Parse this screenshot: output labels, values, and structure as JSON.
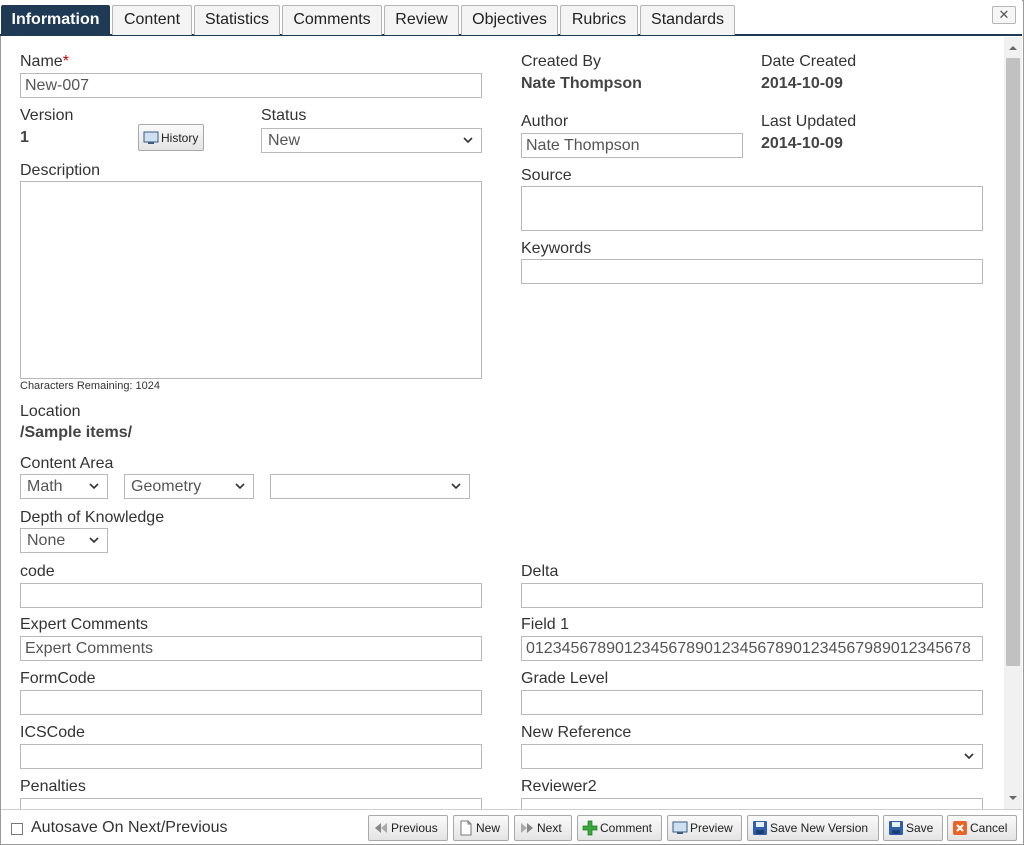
{
  "tabs": [
    {
      "label": "Information"
    },
    {
      "label": "Content"
    },
    {
      "label": "Statistics"
    },
    {
      "label": "Comments"
    },
    {
      "label": "Review"
    },
    {
      "label": "Objectives"
    },
    {
      "label": "Rubrics"
    },
    {
      "label": "Standards"
    }
  ],
  "close_label": "✕",
  "form": {
    "name_label": "Name",
    "required_mark": "*",
    "name_value": "New-007",
    "created_by_label": "Created By",
    "created_by_value": "Nate Thompson",
    "date_created_label": "Date Created",
    "date_created_value": "2014-10-09",
    "version_label": "Version",
    "version_value": "1",
    "history_label": "History",
    "status_label": "Status",
    "status_value": "New",
    "author_label": "Author",
    "author_value": "Nate Thompson",
    "last_updated_label": "Last Updated",
    "last_updated_value": "2014-10-09",
    "description_label": "Description",
    "chars_remaining": "Characters Remaining: 1024",
    "source_label": "Source",
    "keywords_label": "Keywords",
    "location_label": "Location",
    "location_value": "/Sample items/",
    "content_area_label": "Content Area",
    "content_area_1": "Math",
    "content_area_2": "Geometry",
    "content_area_3": "",
    "dok_label": "Depth of Knowledge",
    "dok_value": "None",
    "code_label": "code",
    "delta_label": "Delta",
    "expert_comments_label": "Expert Comments",
    "expert_comments_value": "Expert Comments",
    "field1_label": "Field 1",
    "field1_value": "01234567890123456789012345678901234567989012345678",
    "formcode_label": "FormCode",
    "grade_level_label": "Grade Level",
    "icscode_label": "ICSCode",
    "new_reference_label": "New Reference",
    "penalties_label": "Penalties",
    "reviewer2_label": "Reviewer2"
  },
  "footer": {
    "autosave_label": "Autosave On Next/Previous",
    "previous": "Previous",
    "new": "New",
    "next": "Next",
    "comment": "Comment",
    "preview": "Preview",
    "save_new_version": "Save New Version",
    "save": "Save",
    "cancel": "Cancel"
  },
  "colors": {
    "active_tab": "#1f3a55",
    "required": "#cc0000"
  }
}
